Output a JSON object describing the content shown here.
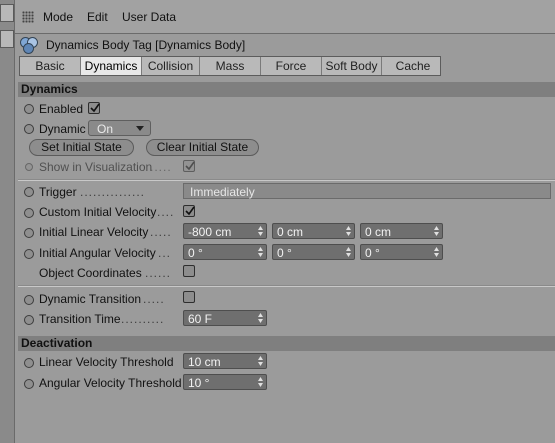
{
  "menu": {
    "items": [
      "Mode",
      "Edit",
      "User Data"
    ]
  },
  "header": {
    "title": "Dynamics Body Tag [Dynamics Body]"
  },
  "tabs": [
    "Basic",
    "Dynamics",
    "Collision",
    "Mass",
    "Force",
    "Soft Body",
    "Cache"
  ],
  "active_tab": "Dynamics",
  "sections": {
    "dynamics": "Dynamics",
    "deactivation": "Deactivation"
  },
  "dynamics": {
    "enabled": {
      "label": "Enabled",
      "checked": true
    },
    "dynamic": {
      "label": "Dynamic",
      "value": "On"
    },
    "set_initial_state": "Set Initial State",
    "clear_initial_state": "Clear Initial State",
    "show_in_visualization": {
      "label": "Show in Visualization",
      "dots": ".....",
      "checked": true
    },
    "trigger": {
      "label": "Trigger",
      "dots": "...............",
      "value": "Immediately"
    },
    "custom_initial_velocity": {
      "label": "Custom Initial Velocity",
      "dots": "....",
      "checked": true
    },
    "initial_linear_velocity": {
      "label": "Initial Linear Velocity",
      "dots": ".....",
      "values": [
        "-800 cm",
        "0 cm",
        "0 cm"
      ]
    },
    "initial_angular_velocity": {
      "label": "Initial Angular Velocity",
      "dots": "...",
      "values": [
        "0 °",
        "0 °",
        "0 °"
      ]
    },
    "object_coordinates": {
      "label": "Object Coordinates",
      "dots": "......",
      "checked": false
    },
    "dynamic_transition": {
      "label": "Dynamic Transition",
      "dots": ".....",
      "checked": false
    },
    "transition_time": {
      "label": "Transition Time",
      "dots": "..........",
      "value": "60 F"
    }
  },
  "deactivation": {
    "linear_velocity_threshold": {
      "label": "Linear Velocity Threshold",
      "value": "10 cm"
    },
    "angular_velocity_threshold": {
      "label": "Angular Velocity Threshold",
      "value": "10 °"
    }
  },
  "colors": {
    "panel_bg": "#9b9b9b",
    "section_bg": "#7f7f7f",
    "field_bg": "#6f6f6f",
    "active_tab": "#e8e8e8"
  }
}
